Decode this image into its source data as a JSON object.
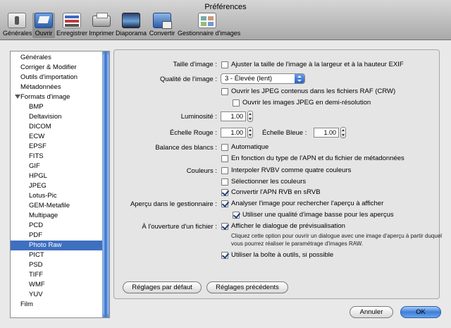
{
  "window": {
    "title": "Préférences"
  },
  "toolbar": [
    {
      "label": "Générales"
    },
    {
      "label": "Ouvrir"
    },
    {
      "label": "Enregistrer"
    },
    {
      "label": "Imprimer"
    },
    {
      "label": "Diaporama"
    },
    {
      "label": "Convertir"
    },
    {
      "label": "Gestionnaire d'images"
    }
  ],
  "sidebar": {
    "items": [
      {
        "label": "Générales",
        "indent": 0
      },
      {
        "label": "Corriger & Modifier",
        "indent": 0
      },
      {
        "label": "Outils d'importation",
        "indent": 0
      },
      {
        "label": "Métadonnées",
        "indent": 0
      },
      {
        "label": "Formats d'image",
        "indent": 0,
        "expanded": true
      },
      {
        "label": "BMP",
        "indent": 1
      },
      {
        "label": "Deltavision",
        "indent": 1
      },
      {
        "label": "DICOM",
        "indent": 1
      },
      {
        "label": "ECW",
        "indent": 1
      },
      {
        "label": "EPSF",
        "indent": 1
      },
      {
        "label": "FITS",
        "indent": 1
      },
      {
        "label": "GIF",
        "indent": 1
      },
      {
        "label": "HPGL",
        "indent": 1
      },
      {
        "label": "JPEG",
        "indent": 1
      },
      {
        "label": "Lotus-Pic",
        "indent": 1
      },
      {
        "label": "GEM-Metafile",
        "indent": 1
      },
      {
        "label": "Multipage",
        "indent": 1
      },
      {
        "label": "PCD",
        "indent": 1
      },
      {
        "label": "PDF",
        "indent": 1
      },
      {
        "label": "Photo Raw",
        "indent": 1,
        "selected": true
      },
      {
        "label": "PICT",
        "indent": 1
      },
      {
        "label": "PSD",
        "indent": 1
      },
      {
        "label": "TIFF",
        "indent": 1
      },
      {
        "label": "WMF",
        "indent": 1
      },
      {
        "label": "YUV",
        "indent": 1
      },
      {
        "label": "Film",
        "indent": 0
      }
    ]
  },
  "form": {
    "taille_label": "Taille d'image :",
    "taille_cb": "Ajuster la taille de l'image à la largeur et à la hauteur EXIF",
    "qualite_label": "Qualité de l'image :",
    "qualite_value": "3 - Élevée (lent)",
    "raf_cb": "Ouvrir les JPEG contenus dans les fichiers RAF (CRW)",
    "demires_cb": "Ouvrir les images JPEG en demi-résolution",
    "lum_label": "Luminosité :",
    "lum_value": "1.00",
    "rouge_label": "Échelle Rouge :",
    "rouge_value": "1.00",
    "bleue_label": "Échelle Bleue :",
    "bleue_value": "1.00",
    "balance_label": "Balance des blancs :",
    "auto_cb": "Automatique",
    "apn_cb": "En fonction du type de l'APN et du fichier de métadonnées",
    "couleurs_label": "Couleurs :",
    "rvbv_cb": "Interpoler RVBV comme quatre couleurs",
    "select_cb": "Sélectionner les couleurs",
    "srvb_cb": "Convertir l'APN RVB en sRVB",
    "apercu_label": "Aperçu dans le gestionnaire :",
    "analyser_cb": "Analyser l'image pour rechercher l'aperçu à afficher",
    "qualite_basse_cb": "Utiliser une qualité d'image basse pour les aperçus",
    "ouverture_label": "À l'ouverture d'un fichier :",
    "dialogue_cb": "Afficher le dialogue de prévisualisation",
    "dialogue_note": "Cliquez cette option pour ouvrir un dialogue avec une image d'aperçu à partir duquel vous pourrez réaliser le paramétrage d'images RAW.",
    "boite_cb": "Utiliser la boîte à outils, si possible",
    "defaut_button": "Réglages par défaut",
    "precedents_button": "Réglages précédents"
  },
  "footer": {
    "cancel": "Annuler",
    "ok": "OK"
  }
}
